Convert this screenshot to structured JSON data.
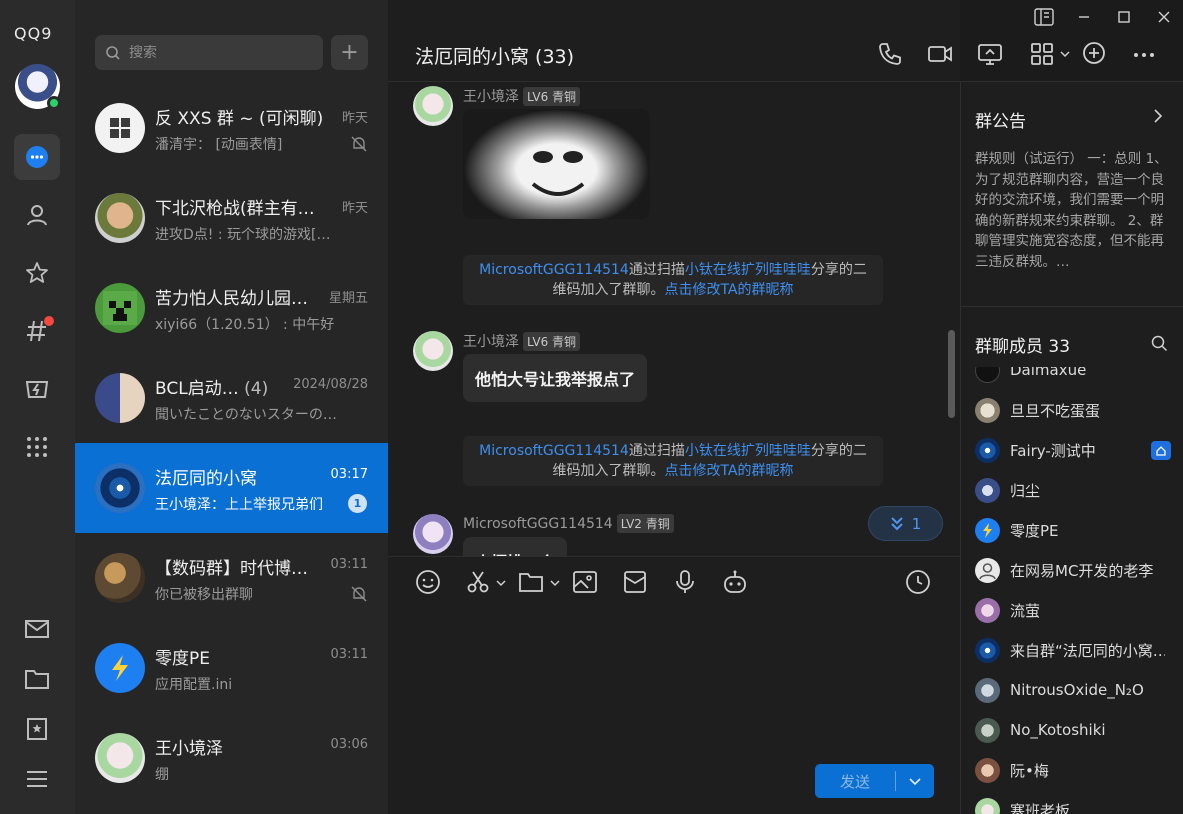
{
  "app": {
    "logo": "QQ9"
  },
  "search": {
    "placeholder": "搜索"
  },
  "conversations": [
    {
      "name": "反 XXS 群 ~ (可闲聊)",
      "time": "昨天",
      "preview": "潘清宇：  [动画表情]",
      "muted": true
    },
    {
      "name": "下北沢枪战(群主有…",
      "time": "昨天",
      "preview": "进攻D点!  :  玩个球的游戏[…",
      "muted": false
    },
    {
      "name": "苦力怕人民幼儿园…",
      "time": "星期五",
      "preview": "xiyi66（1.20.51） :  中午好",
      "muted": false
    },
    {
      "name": "BCL启动…",
      "count": "(4)",
      "time": "2024/08/28",
      "preview": "聞いたことのないスターの…",
      "muted": false
    },
    {
      "name": "法厄同的小窝",
      "time": "03:17",
      "preview": "王小境泽：上上举报兄弟们",
      "unread": "1",
      "active": true
    },
    {
      "name": "【数码群】时代博…",
      "time": "03:11",
      "preview": "你已被移出群聊",
      "muted": true
    },
    {
      "name": "零度PE",
      "time": "03:11",
      "preview": "应用配置.ini",
      "muted": false
    },
    {
      "name": "王小境泽",
      "time": "03:06",
      "preview": "绷",
      "muted": false
    }
  ],
  "chat": {
    "title": "法厄同的小窝 (33)",
    "messages": {
      "m1_sender": "王小境泽",
      "m1_level": "LV6 青铜",
      "sys1_a": "MicrosoftGGG114514",
      "sys1_b": "通过扫描",
      "sys1_c": "小钛在线扩列哇哇哇",
      "sys1_d": "分享的二维码加入了群聊。",
      "sys1_e": "点击修改TA的群昵称",
      "m2_sender": "王小境泽",
      "m2_level": "LV6 青铜",
      "m2_text": "他怕大号让我举报点了",
      "sys2_a": "MicrosoftGGG114514",
      "sys2_b": "通过扫描",
      "sys2_c": "小钛在线扩列哇哇哇",
      "sys2_d": "分享的二维码加入了群聊。",
      "sys2_e": "点击修改TA的群昵称",
      "m3_sender": "MicrosoftGGG114514",
      "m3_level": "LV2 青铜",
      "m3_text": "小榧桃一个"
    },
    "new_messages_count": "1",
    "send_label": "发送"
  },
  "side": {
    "notice_title": "群公告",
    "notice_text": "群规则（试运行） 一：总则 1、为了规范群聊内容，营造一个良好的交流环境，我们需要一个明确的新群规来约束群聊。 2、群聊管理实施宽容态度，但不能再三违反群规。…",
    "members_title": "群聊成员 33",
    "members": [
      {
        "name": "Daimaxue"
      },
      {
        "name": "旦旦不吃蛋蛋"
      },
      {
        "name": "Fairy-测试中"
      },
      {
        "name": "归尘"
      },
      {
        "name": "零度PE"
      },
      {
        "name": "在网易MC开发的老李"
      },
      {
        "name": "流萤"
      },
      {
        "name": "来自群“法厄同的小窝…"
      },
      {
        "name": "NitrousOxide_N₂O"
      },
      {
        "name": "No_Kotoshiki"
      },
      {
        "name": "阮•梅"
      },
      {
        "name": "寒班老板"
      }
    ]
  },
  "colors": {
    "accent": "#0a70d3",
    "link": "#3d8ff0",
    "online": "#2bd26a",
    "badge": "#f5483f"
  }
}
